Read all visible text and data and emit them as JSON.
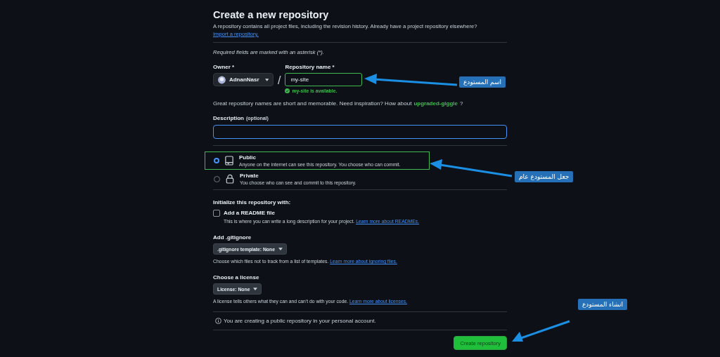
{
  "heading": "Create a new repository",
  "intro": {
    "text": "A repository contains all project files, including the revision history. Already have a project repository elsewhere?",
    "link": "Import a repository."
  },
  "required_note": "Required fields are marked with an asterisk (*).",
  "owner": {
    "label": "Owner *",
    "value": "AdnanNasr"
  },
  "separator": "/",
  "repository_name": {
    "label": "Repository name *",
    "value": "my-site",
    "status": "my-site is available."
  },
  "suggestion": {
    "text": "Great repository names are short and memorable. Need inspiration? How about",
    "name": "upgraded-giggle",
    "suffix": "?"
  },
  "description": {
    "label": "Description",
    "hint": "(optional)"
  },
  "visibility": [
    {
      "kind": "public",
      "title": "Public",
      "text": "Anyone on the internet can see this repository. You choose who can commit.",
      "selected": true
    },
    {
      "kind": "private",
      "title": "Private",
      "text": "You choose who can see and commit to this repository.",
      "selected": false
    }
  ],
  "initialize": {
    "heading": "Initialize this repository with:",
    "readme": {
      "label": "Add a README file",
      "checked": false,
      "text": "This is where you can write a long description for your project.",
      "link": "Learn more about READMEs."
    }
  },
  "gitignore": {
    "heading": "Add .gitignore",
    "button": ".gitignore template: None",
    "text": "Choose which files not to track from a list of templates.",
    "link": "Learn more about ignoring files."
  },
  "license": {
    "heading": "Choose a license",
    "button": "License: None",
    "text": "A license tells others what they can and can't do with your code.",
    "link": "Learn more about licenses."
  },
  "notice": "You are creating a public repository in your personal account.",
  "create_button": "Create repository",
  "annotations": [
    {
      "text": "اسم المستودع"
    },
    {
      "text": "جعل المستودع عام"
    },
    {
      "text": "انشاء المستودع"
    }
  ]
}
